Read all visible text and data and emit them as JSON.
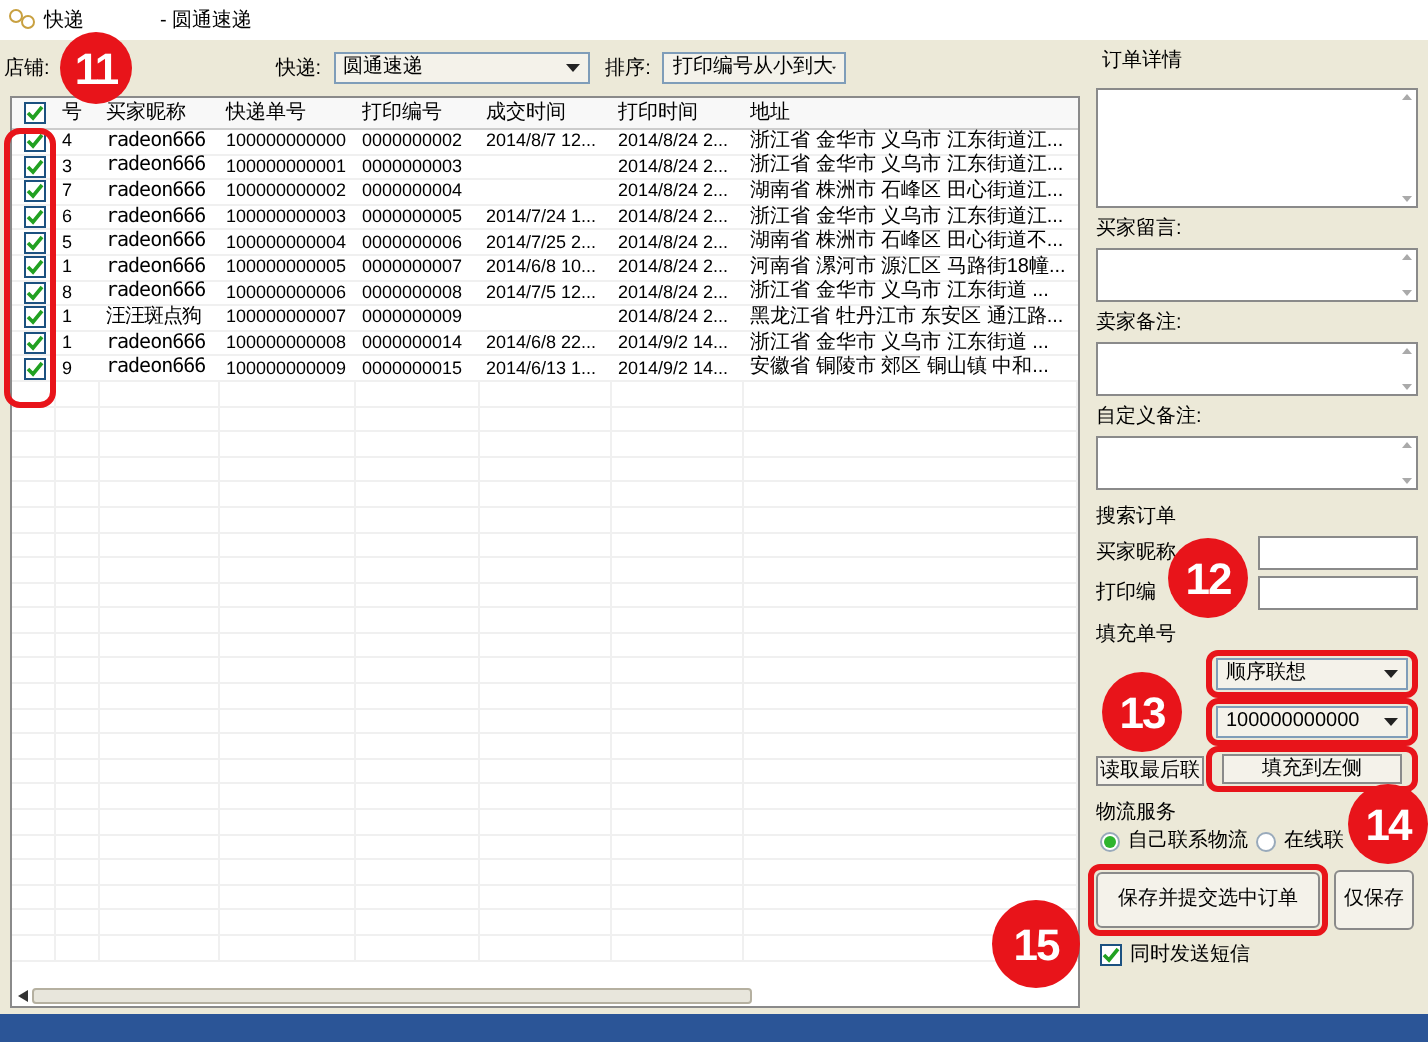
{
  "window": {
    "title_parts": [
      "快递",
      "- 圆通速递"
    ]
  },
  "toolbar": {
    "shop_label": "店铺:",
    "courier_label": "快递:",
    "courier_value": "圆通速递",
    "sort_label": "排序:",
    "sort_value": "打印编号从小到大"
  },
  "table": {
    "all_checked": true,
    "columns": [
      "号",
      "买家昵称",
      "快递单号",
      "打印编号",
      "成交时间",
      "打印时间",
      "地址"
    ],
    "rows": [
      {
        "checked": true,
        "cells": [
          "4",
          "radeon666",
          "100000000000",
          "0000000002",
          "2014/8/7 12...",
          "2014/8/24 2...",
          "浙江省 金华市 义乌市 江东街道江..."
        ]
      },
      {
        "checked": true,
        "cells": [
          "3",
          "radeon666",
          "100000000001",
          "0000000003",
          "",
          "2014/8/24 2...",
          "浙江省 金华市 义乌市 江东街道江..."
        ]
      },
      {
        "checked": true,
        "cells": [
          "7",
          "radeon666",
          "100000000002",
          "0000000004",
          "",
          "2014/8/24 2...",
          "湖南省 株洲市 石峰区 田心街道江..."
        ]
      },
      {
        "checked": true,
        "cells": [
          "6",
          "radeon666",
          "100000000003",
          "0000000005",
          "2014/7/24 1...",
          "2014/8/24 2...",
          "浙江省 金华市 义乌市 江东街道江..."
        ]
      },
      {
        "checked": true,
        "cells": [
          "5",
          "radeon666",
          "100000000004",
          "0000000006",
          "2014/7/25 2...",
          "2014/8/24 2...",
          "湖南省 株洲市 石峰区 田心街道不..."
        ]
      },
      {
        "checked": true,
        "cells": [
          "1",
          "radeon666",
          "100000000005",
          "0000000007",
          "2014/6/8 10...",
          "2014/8/24 2...",
          "河南省 漯河市 源汇区 马路街18幢..."
        ]
      },
      {
        "checked": true,
        "cells": [
          "8",
          "radeon666",
          "100000000006",
          "0000000008",
          "2014/7/5 12...",
          "2014/8/24 2...",
          "浙江省 金华市 义乌市 江东街道 ..."
        ]
      },
      {
        "checked": true,
        "cells": [
          "1",
          "汪汪斑点狗",
          "100000000007",
          "0000000009",
          "",
          "2014/8/24 2...",
          "黑龙江省 牡丹江市 东安区 通江路..."
        ]
      },
      {
        "checked": true,
        "cells": [
          "1",
          "radeon666",
          "100000000008",
          "0000000014",
          "2014/6/8 22...",
          "2014/9/2 14...",
          "浙江省 金华市 义乌市 江东街道 ..."
        ]
      },
      {
        "checked": true,
        "cells": [
          "9",
          "radeon666",
          "100000000009",
          "0000000015",
          "2014/6/13 1...",
          "2014/9/2 14...",
          "安徽省 铜陵市 郊区 铜山镇 中和..."
        ]
      }
    ]
  },
  "details": {
    "title": "订单详情",
    "notes": [
      {
        "label": "买家留言:"
      },
      {
        "label": "卖家备注:"
      },
      {
        "label": "自定义备注:"
      }
    ]
  },
  "search": {
    "title": "搜索订单",
    "fields": [
      {
        "label": "买家昵称"
      },
      {
        "label": "打印编"
      }
    ]
  },
  "fill": {
    "title": "填充单号",
    "mode": "顺序联想",
    "number": "100000000000",
    "read_button": "读取最后联",
    "fill_button": "填充到左侧"
  },
  "logistics": {
    "title": "物流服务",
    "options": [
      {
        "label": "自己联系物流",
        "selected": true
      },
      {
        "label": "在线联",
        "selected": false
      }
    ]
  },
  "actions": [
    "保存并提交选中订单",
    "仅保存"
  ],
  "sms": {
    "label": "同时发送短信",
    "checked": true
  },
  "annotations": [
    {
      "label": "11"
    },
    {
      "label": "12"
    },
    {
      "label": "13"
    },
    {
      "label": "14"
    },
    {
      "label": "15"
    }
  ]
}
